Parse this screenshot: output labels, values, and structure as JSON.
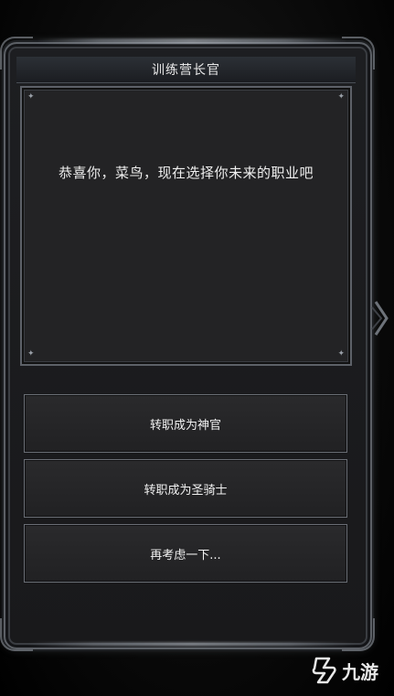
{
  "dialog": {
    "npc_title": "训练营长官",
    "message": "恭喜你，菜鸟，现在选择你未来的职业吧"
  },
  "options": [
    {
      "label": "转职成为神官"
    },
    {
      "label": "转职成为圣骑士"
    },
    {
      "label": "再考虑一下..."
    }
  ],
  "watermark": {
    "text": "九游",
    "icon": "jiuyou-logo-icon"
  },
  "icons": {
    "side_arrow": "chevron-right-icon",
    "corner_sparkles": "sparkle-icon"
  },
  "colors": {
    "frame_silver": "#8d939b",
    "panel_bg": "#232325",
    "text": "#f0f0f0"
  }
}
